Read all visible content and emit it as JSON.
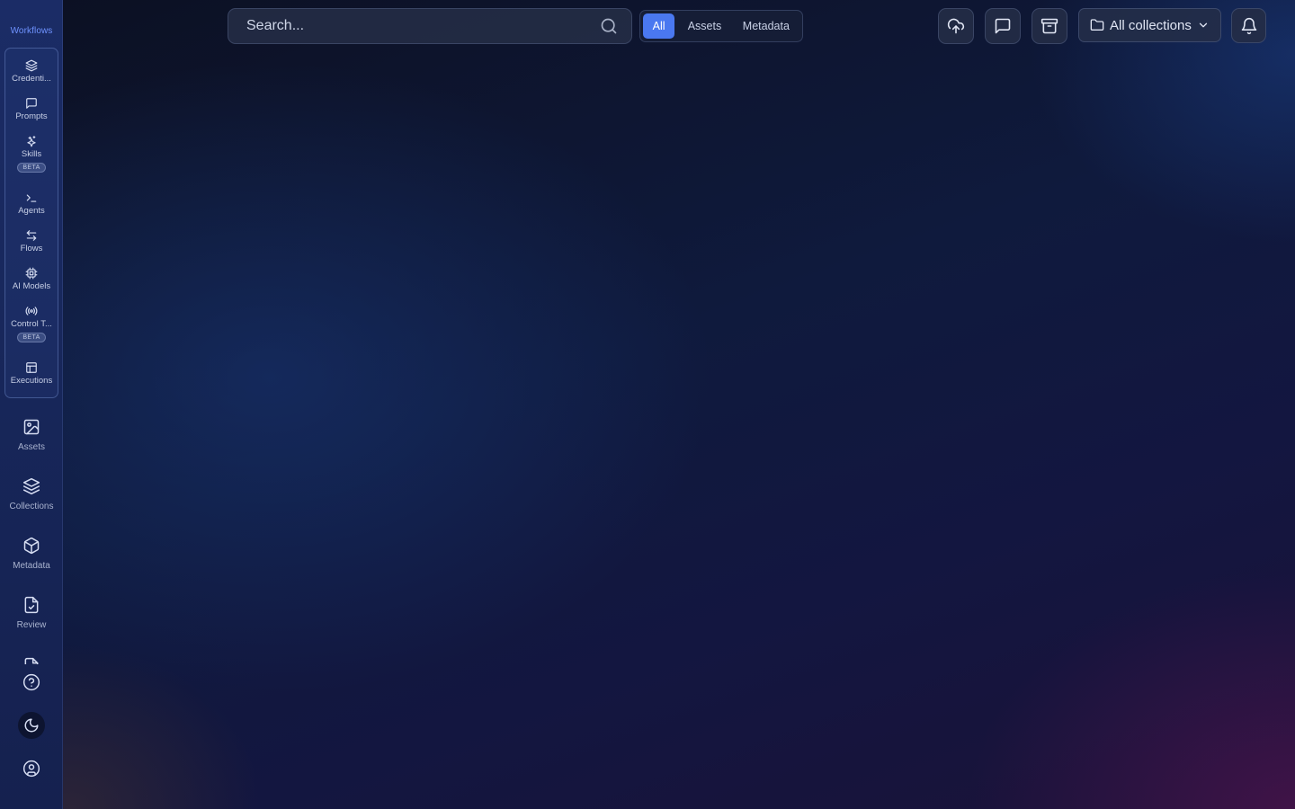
{
  "sidebar": {
    "section_label": "Workflows",
    "workflow_items": [
      {
        "label": "Credenti...",
        "icon": "layers-icon"
      },
      {
        "label": "Prompts",
        "icon": "message-square-icon"
      },
      {
        "label": "Skills",
        "icon": "sparkles-icon",
        "badge": "BETA"
      },
      {
        "label": "Agents",
        "icon": "terminal-icon"
      },
      {
        "label": "Flows",
        "icon": "arrows-left-right-icon"
      },
      {
        "label": "AI Models",
        "icon": "cpu-icon"
      },
      {
        "label": "Control T...",
        "icon": "radio-tower-icon",
        "badge": "BETA"
      },
      {
        "label": "Executions",
        "icon": "table-icon"
      }
    ],
    "main_items": [
      {
        "label": "Assets",
        "icon": "image-icon"
      },
      {
        "label": "Collections",
        "icon": "layers-icon"
      },
      {
        "label": "Metadata",
        "icon": "box-icon"
      },
      {
        "label": "Review",
        "icon": "file-check-icon"
      }
    ],
    "bottom": {
      "help_icon": "help-circle-icon",
      "theme_icon": "moon-icon",
      "account_icon": "user-circle-icon"
    }
  },
  "topbar": {
    "search": {
      "placeholder": "Search...",
      "value": ""
    },
    "filter_tabs": [
      {
        "label": "All",
        "active": true
      },
      {
        "label": "Assets",
        "active": false
      },
      {
        "label": "Metadata",
        "active": false
      }
    ],
    "actions": [
      "upload-cloud-icon",
      "message-square-icon",
      "archive-icon"
    ],
    "collection_select": {
      "label": "All collections"
    },
    "notifications_icon": "bell-icon"
  },
  "colors": {
    "accent": "#4a78f0",
    "section_label": "#6f93ff",
    "sidebar_bg": "#1b2c66"
  }
}
